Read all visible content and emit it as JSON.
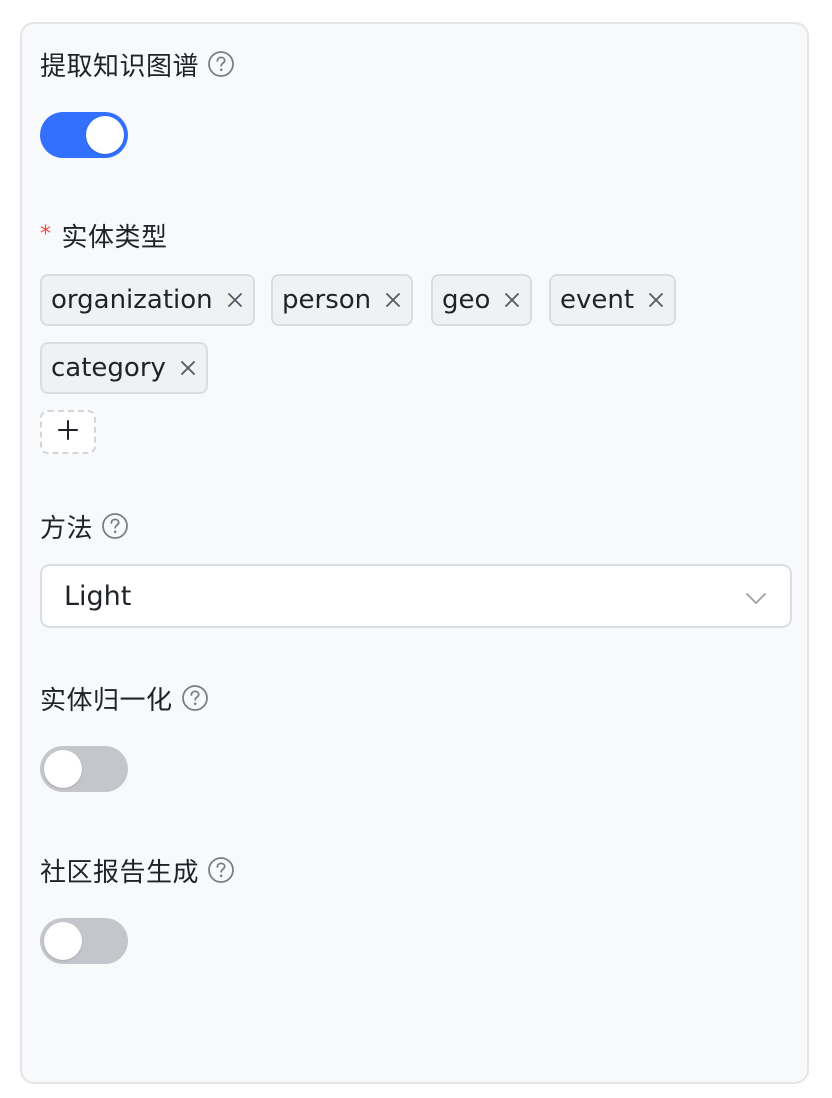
{
  "knowledge_graph": {
    "label": "提取知识图谱",
    "enabled": true
  },
  "entity_types": {
    "label": "实体类型",
    "required_mark": "*",
    "tags": [
      "organization",
      "person",
      "geo",
      "event",
      "category"
    ],
    "add_glyph": "+"
  },
  "method": {
    "label": "方法",
    "selected": "Light"
  },
  "entity_resolution": {
    "label": "实体归一化",
    "enabled": false
  },
  "community_report": {
    "label": "社区报告生成",
    "enabled": false
  },
  "colors": {
    "accent": "#3370ff",
    "switch_off": "#c4c6cb",
    "required": "#f04b4b"
  },
  "icons": {
    "help": "question-circle-icon",
    "remove_tag": "close-icon",
    "add": "plus-icon",
    "dropdown": "chevron-down-icon"
  }
}
